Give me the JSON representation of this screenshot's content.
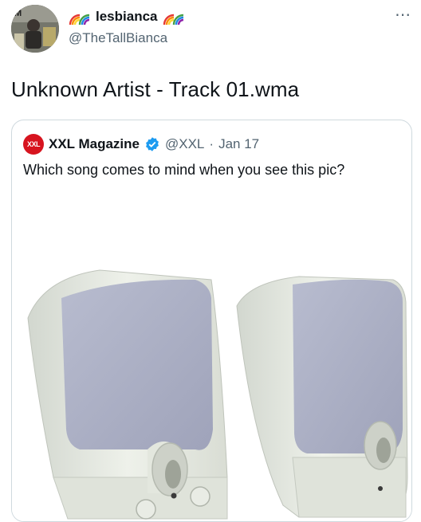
{
  "author": {
    "display_name": "lesbianca",
    "handle": "@TheTallBianca",
    "avatar_icon": "profile-photo"
  },
  "tweet": {
    "text": "Unknown Artist - Track 01.wma"
  },
  "more_icon": "⋯",
  "quoted_tweet": {
    "logo_text": "XXL",
    "author_name": "XXL Magazine",
    "handle": "@XXL",
    "separator": "·",
    "date": "Jan 17",
    "text": "Which song comes to mind when you see this pic?",
    "media": "computer-speakers-photo"
  },
  "colors": {
    "verified_blue": "#1d9bf0",
    "xxl_red": "#d7141f",
    "speaker_grille": "#a9adc3",
    "speaker_body": "#e4e8e0"
  }
}
